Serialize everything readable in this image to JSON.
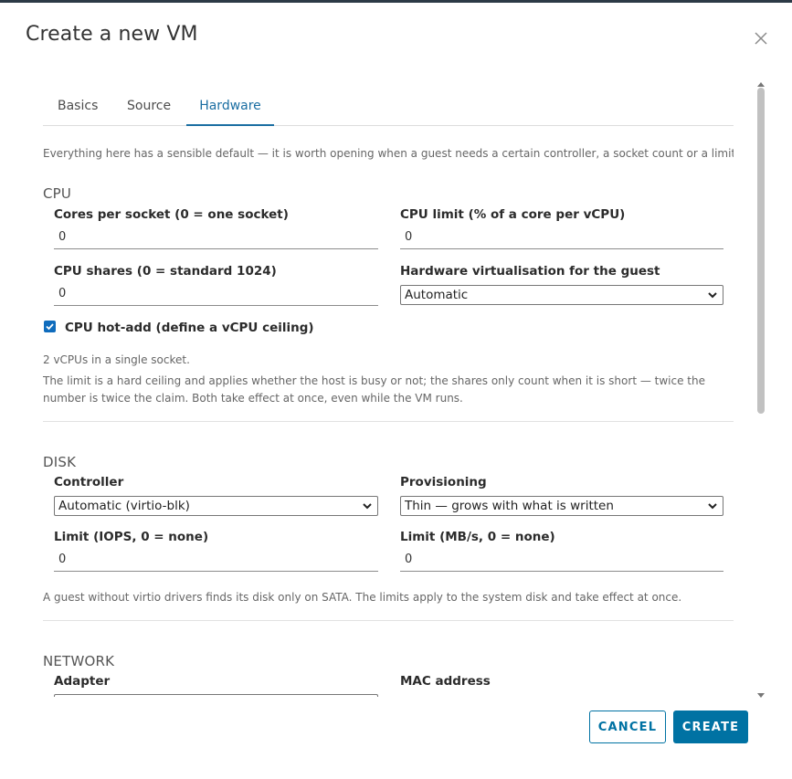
{
  "dialog": {
    "title": "Create a new VM"
  },
  "tabs": [
    {
      "label": "Basics"
    },
    {
      "label": "Source"
    },
    {
      "label": "Hardware"
    }
  ],
  "intro": "Everything here has a sensible default — it is worth opening when a guest needs a certain controller, a socket count or a limit.",
  "cpu": {
    "title": "CPU",
    "cores_label": "Cores per socket (0 = one socket)",
    "cores_value": "0",
    "limit_label": "CPU limit (% of a core per vCPU)",
    "limit_value": "0",
    "shares_label": "CPU shares (0 = standard 1024)",
    "shares_value": "0",
    "virt_label": "Hardware virtualisation for the guest",
    "virt_value": "Automatic",
    "hotadd_label": "CPU hot-add (define a vCPU ceiling)",
    "summary": "2 vCPUs in a single socket.",
    "help": "The limit is a hard ceiling and applies whether the host is busy or not; the shares only count when it is short — twice the number is twice the claim. Both take effect at once, even while the VM runs."
  },
  "disk": {
    "title": "DISK",
    "controller_label": "Controller",
    "controller_value": "Automatic (virtio-blk)",
    "provisioning_label": "Provisioning",
    "provisioning_value": "Thin — grows with what is written",
    "iops_label": "Limit (IOPS, 0 = none)",
    "iops_value": "0",
    "mbps_label": "Limit (MB/s, 0 = none)",
    "mbps_value": "0",
    "help": "A guest without virtio drivers finds its disk only on SATA. The limits apply to the system disk and take effect at once."
  },
  "network": {
    "title": "NETWORK",
    "adapter_label": "Adapter",
    "mac_label": "MAC address"
  },
  "footer": {
    "cancel_label": "CANCEL",
    "create_label": "CREATE"
  },
  "colors": {
    "accent": "#0072a3",
    "tab_active": "#1b6ea2",
    "checkbox": "#0f6cbd"
  }
}
